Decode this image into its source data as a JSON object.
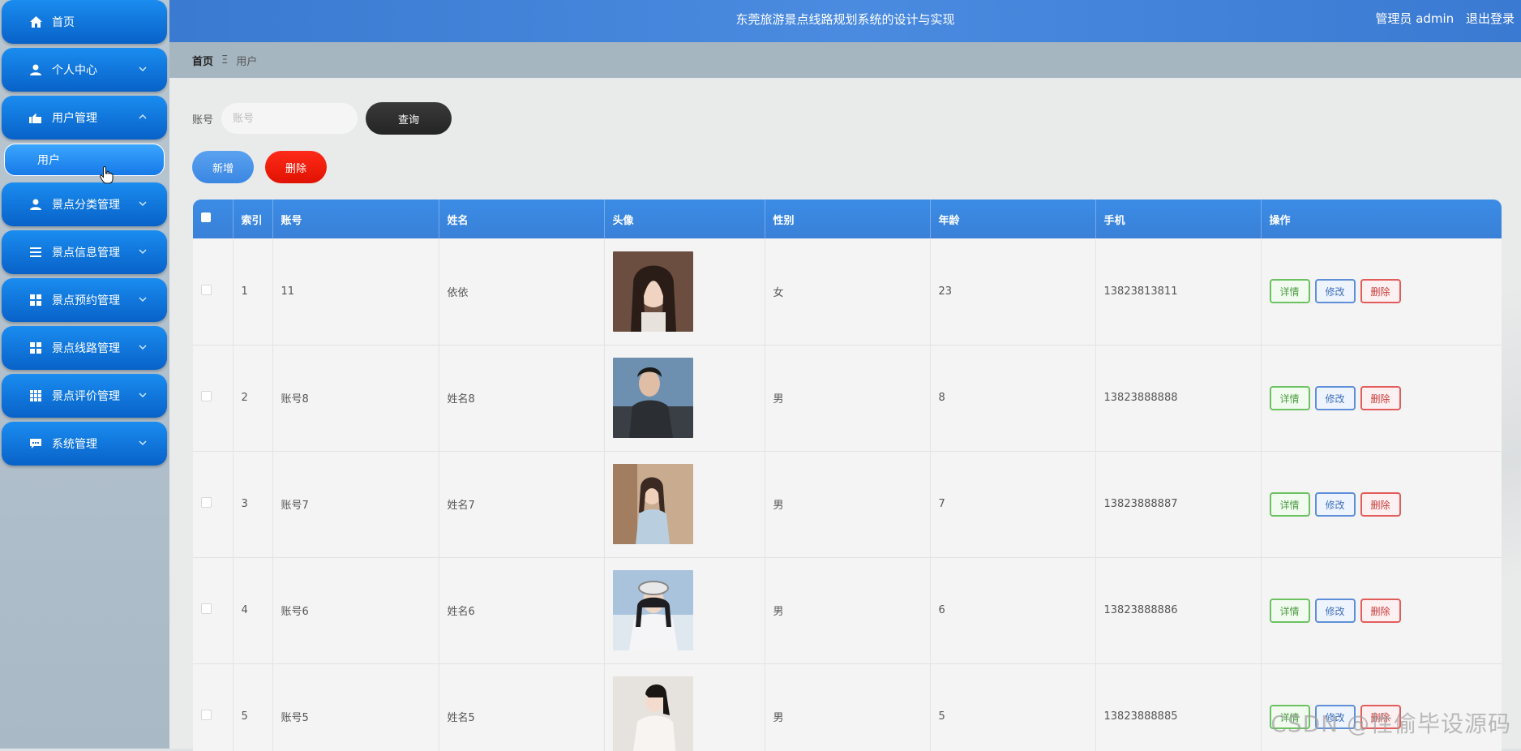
{
  "app": {
    "title": "东莞旅游景点线路规划系统的设计与实现",
    "user_label": "管理员 admin",
    "logout_label": "退出登录"
  },
  "sidebar": {
    "items": [
      {
        "label": "首页",
        "icon": "home-icon"
      },
      {
        "label": "个人中心",
        "icon": "person-icon"
      },
      {
        "label": "用户管理",
        "icon": "users-icon"
      },
      {
        "label": "景点分类管理",
        "icon": "person-icon"
      },
      {
        "label": "景点信息管理",
        "icon": "list-icon"
      },
      {
        "label": "景点预约管理",
        "icon": "grid-icon"
      },
      {
        "label": "景点线路管理",
        "icon": "grid-icon"
      },
      {
        "label": "景点评价管理",
        "icon": "table-grid-icon"
      },
      {
        "label": "系统管理",
        "icon": "chat-icon"
      }
    ],
    "submenu": {
      "label": "用户"
    }
  },
  "breadcrumb": {
    "home": "首页",
    "separator": "Ξ",
    "current": "用户"
  },
  "search": {
    "label": "账号",
    "placeholder": "账号",
    "button": "查询"
  },
  "actions": {
    "add": "新增",
    "delete": "删除"
  },
  "table": {
    "headers": [
      "索引",
      "账号",
      "姓名",
      "头像",
      "性别",
      "年龄",
      "手机",
      "操作"
    ],
    "op_labels": {
      "detail": "详情",
      "edit": "修改",
      "remove": "删除"
    },
    "rows": [
      {
        "index": "1",
        "account": "11",
        "name": "依依",
        "gender": "女",
        "age": "23",
        "phone": "13823813811",
        "avatar_color": "#5a3f36"
      },
      {
        "index": "2",
        "account": "账号8",
        "name": "姓名8",
        "gender": "男",
        "age": "8",
        "phone": "13823888888",
        "avatar_color": "#3c4a58"
      },
      {
        "index": "3",
        "account": "账号7",
        "name": "姓名7",
        "gender": "男",
        "age": "7",
        "phone": "13823888887",
        "avatar_color": "#b89a84"
      },
      {
        "index": "4",
        "account": "账号6",
        "name": "姓名6",
        "gender": "男",
        "age": "6",
        "phone": "13823888886",
        "avatar_color": "#9bb5d2"
      },
      {
        "index": "5",
        "account": "账号5",
        "name": "姓名5",
        "gender": "男",
        "age": "5",
        "phone": "13823888885",
        "avatar_color": "#d9d4cf"
      }
    ]
  },
  "watermark": "CSDN @性偷毕设源码"
}
